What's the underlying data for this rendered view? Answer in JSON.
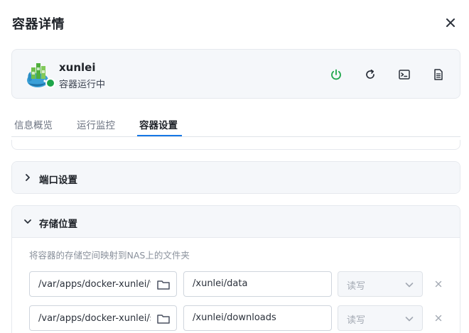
{
  "dialog": {
    "title": "容器详情"
  },
  "container": {
    "name": "xunlei",
    "status_text": "容器运行中",
    "status_color": "#1ea54a"
  },
  "tabs": [
    {
      "label": "信息概览",
      "active": false
    },
    {
      "label": "运行监控",
      "active": false
    },
    {
      "label": "容器设置",
      "active": true
    }
  ],
  "sections": {
    "ports": {
      "label": "端口设置",
      "expanded": false
    },
    "storage": {
      "label": "存储位置",
      "expanded": true,
      "hint": "将容器的存储空间映射到NAS上的文件夹",
      "mappings": [
        {
          "host_path": "/var/apps/docker-xunlei/t",
          "container_path": "/xunlei/data",
          "permission": "读写"
        },
        {
          "host_path": "/var/apps/docker-xunlei/s",
          "container_path": "/xunlei/downloads",
          "permission": "读写"
        }
      ]
    }
  },
  "icons": {
    "close": "close-icon",
    "power": "power-icon",
    "restart": "restart-icon",
    "terminal": "terminal-icon",
    "logs": "log-file-icon",
    "folder": "folder-icon",
    "dropdown": "chevron-down-icon",
    "remove": "remove-icon"
  },
  "colors": {
    "accent": "#1677e5",
    "running": "#1ea54a",
    "power_icon": "#1ea54a"
  }
}
